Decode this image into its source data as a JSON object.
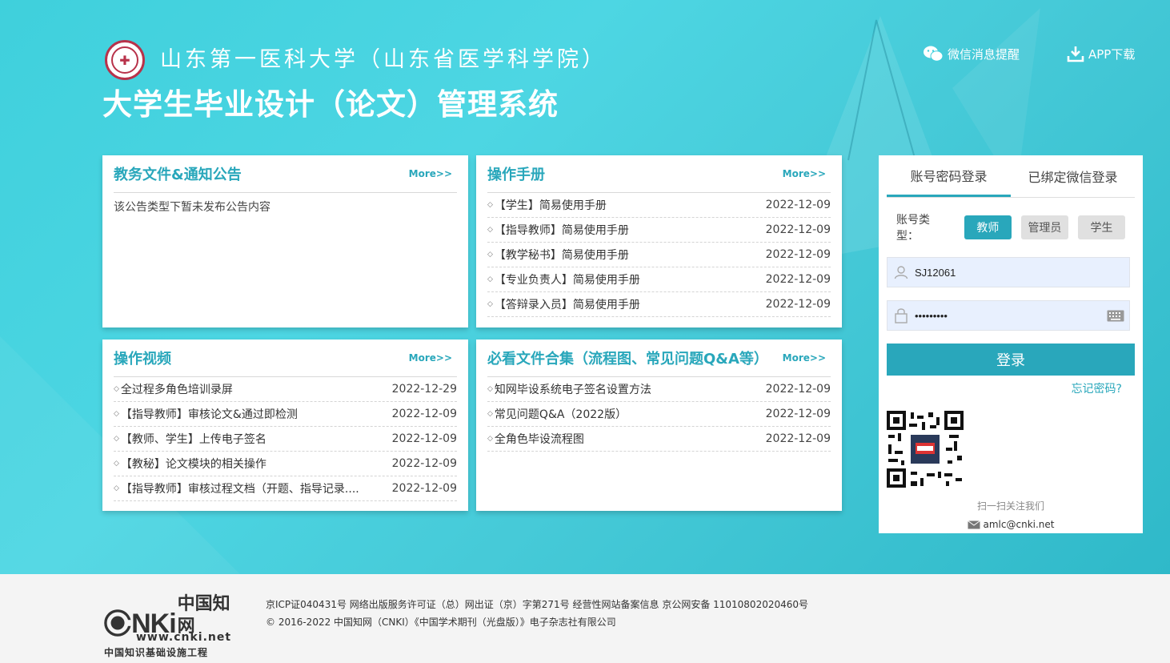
{
  "header": {
    "university": "山东第一医科大学（山东省医学科学院）",
    "system_title": "大学生毕业设计（论文）管理系统",
    "wechat_link": "微信消息提醒",
    "app_link": "APP下载"
  },
  "notices": {
    "title": "教务文件&通知公告",
    "more": "More>>",
    "empty": "该公告类型下暂未发布公告内容"
  },
  "manual": {
    "title": "操作手册",
    "more": "More>>",
    "items": [
      {
        "title": "【学生】简易使用手册",
        "date": "2022-12-09"
      },
      {
        "title": "【指导教师】简易使用手册",
        "date": "2022-12-09"
      },
      {
        "title": "【教学秘书】简易使用手册",
        "date": "2022-12-09"
      },
      {
        "title": "【专业负责人】简易使用手册",
        "date": "2022-12-09"
      },
      {
        "title": "【答辩录入员】简易使用手册",
        "date": "2022-12-09"
      }
    ]
  },
  "videos": {
    "title": "操作视频",
    "more": "More>>",
    "items": [
      {
        "title": "全过程多角色培训录屏",
        "date": "2022-12-29"
      },
      {
        "title": "【指导教师】审核论文&通过即检测",
        "date": "2022-12-09"
      },
      {
        "title": "【教师、学生】上传电子签名",
        "date": "2022-12-09"
      },
      {
        "title": "【教秘】论文模块的相关操作",
        "date": "2022-12-09"
      },
      {
        "title": "【指导教师】审核过程文档（开题、指导记录....",
        "date": "2022-12-09"
      }
    ]
  },
  "docs": {
    "title": "必看文件合集（流程图、常见问题Q&A等）",
    "more": "More>>",
    "items": [
      {
        "title": "知网毕设系统电子签名设置方法",
        "date": "2022-12-09"
      },
      {
        "title": "常见问题Q&A（2022版）",
        "date": "2022-12-09"
      },
      {
        "title": "全角色毕设流程图",
        "date": "2022-12-09"
      }
    ]
  },
  "login": {
    "tab_password": "账号密码登录",
    "tab_wechat": "已绑定微信登录",
    "account_type_label": "账号类型：",
    "roles": [
      "教师",
      "管理员",
      "学生"
    ],
    "active_role": "教师",
    "username": "SJ12061",
    "password": "•••••••••",
    "login_button": "登录",
    "forgot": "忘记密码?",
    "qr_caption": "扫一扫关注我们",
    "email": "amlc@cnki.net"
  },
  "footer": {
    "logo_cn": "中国知网",
    "logo_www": "www.cnki.net",
    "logo_sub": "中国知识基础设施工程",
    "line1": "京ICP证040431号  网络出版服务许可证（总）网出证（京）字第271号  经营性网站备案信息 京公网安备 11010802020460号",
    "line2": "© 2016-2022 中国知网（CNKI）《中国学术期刊（光盘版）》电子杂志社有限公司"
  },
  "colors": {
    "accent": "#29a7bb",
    "hero_bg": "#46cad8"
  }
}
